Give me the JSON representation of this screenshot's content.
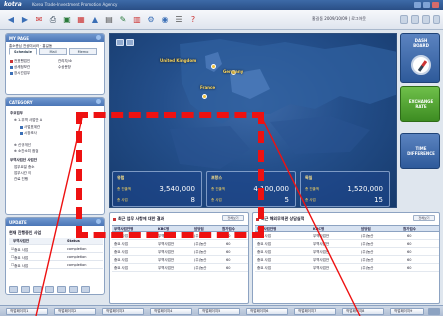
{
  "titlebar": {
    "logo": "kotra",
    "title": "Korea Trade-Investment Promotion Agency"
  },
  "toolbar": {
    "user": "홍길동 2009/10/09 | 로그아웃"
  },
  "sidebar": {
    "mypage": {
      "title": "MY PAGE",
      "user": "홍소총님 전상미씨러 · 홍길동",
      "tabs": [
        "Schedule",
        "Mail",
        "Memo"
      ],
      "lines": [
        "전표팬업인",
        "상세정보관",
        "장시간업무"
      ],
      "right_lines": [
        "관리자/소",
        "수상문장"
      ]
    },
    "category": {
      "title": "CATEGORY",
      "items": [
        "주요업무",
        "1.무역 사업안 A",
        "사업표계관",
        "시장조사",
        "신규개선",
        "소간소치 점검",
        "무역사업단 사업안"
      ],
      "sub": [
        "업무요일 종소",
        "업무시간 이",
        "관료 진행"
      ]
    },
    "update": {
      "title": "UPDATE",
      "subtitle": "현재 진행중인 사업",
      "header": [
        "무역사업안",
        "Status"
      ],
      "rows": [
        [
          "중요 사업",
          "completion"
        ],
        [
          "중요 사업",
          "completion"
        ],
        [
          "중요 사업",
          "completion"
        ]
      ]
    }
  },
  "map": {
    "countries": [
      "United Kingdom",
      "Germany",
      "France"
    ],
    "stats": [
      {
        "region": "유럽",
        "l1": "총 진출액",
        "v1": "3,540,000",
        "l2": "총 사업",
        "v2": "8"
      },
      {
        "region": "프랑스",
        "l1": "총 진출액",
        "v1": "4,100,000",
        "l2": "총 사업",
        "v2": "5"
      },
      {
        "region": "독일",
        "l1": "총 진출액",
        "v1": "1,520,000",
        "l2": "총 사업",
        "v2": "15"
      }
    ]
  },
  "right_buttons": {
    "dashboard": "DASH\nBOARD",
    "exchange": "EXCHANGE\nRATE",
    "time": "TIME\nDIFFERENCE"
  },
  "lower_left": {
    "title": "최근 업무 사항에 대한 결과",
    "more": "전체보기",
    "columns": [
      "무역사업안명",
      "KBC명",
      "담당팀",
      "참가업수"
    ],
    "rows": [
      [
        "중요 사업",
        "무역사업안",
        "(주)농산",
        "60"
      ],
      [
        "중요 사업",
        "무역사업안",
        "(주)농산",
        "60"
      ],
      [
        "중요 사업",
        "무역사업안",
        "(주)농산",
        "60"
      ],
      [
        "중요 사업",
        "무역사업안",
        "(주)농산",
        "60"
      ],
      [
        "중요 사업",
        "무역사업안",
        "(주)농산",
        "60"
      ]
    ]
  },
  "lower_right": {
    "title": "최근 해외무역관 상담실적",
    "more": "전체보기",
    "columns": [
      "무역사업안명",
      "KBC명",
      "담당팀",
      "참가업수"
    ],
    "rows": [
      [
        "중요 사업",
        "무역사업안",
        "(주)농산",
        "60"
      ],
      [
        "중요 사업",
        "무역사업안",
        "(주)농산",
        "60"
      ],
      [
        "중요 사업",
        "무역사업안",
        "(주)농산",
        "60"
      ],
      [
        "중요 사업",
        "무역사업안",
        "(주)농산",
        "60"
      ],
      [
        "중요 사업",
        "무역사업안",
        "(주)농산",
        "60"
      ]
    ]
  },
  "taskbar": {
    "items": [
      "작업페이지1",
      "작업페이지2",
      "작업페이지3",
      "작업페이지4",
      "작업페이지5",
      "작업페이지6",
      "작업페이지7",
      "작업페이지8",
      "작업페이지9"
    ]
  }
}
